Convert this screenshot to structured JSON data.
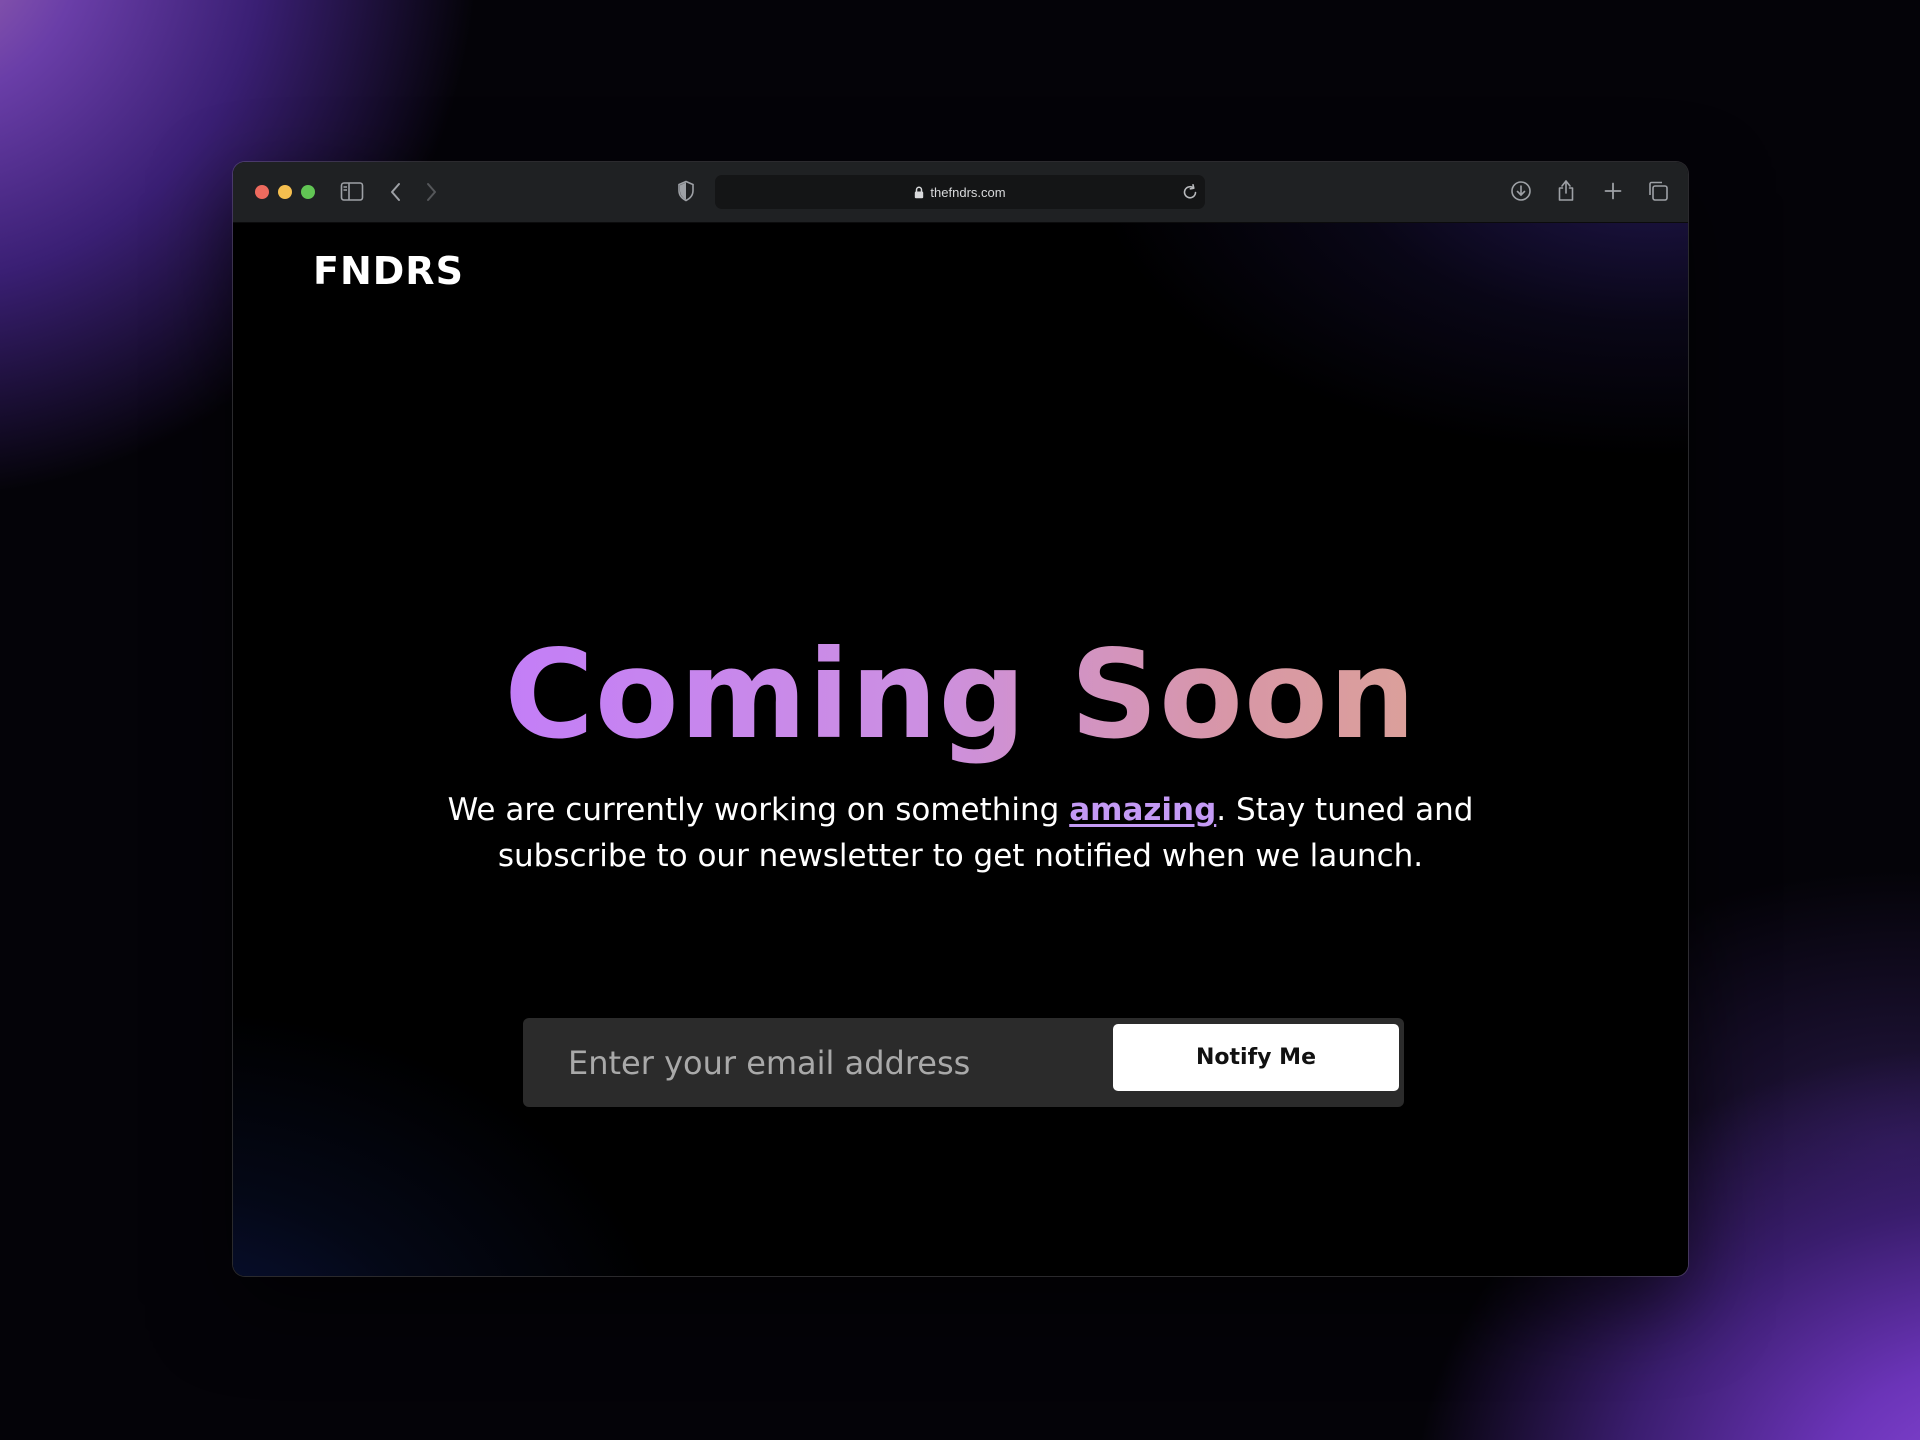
{
  "browser": {
    "url": "thefndrs.com"
  },
  "page": {
    "logo": "FNDRS",
    "headline": "Coming Soon",
    "subtext": {
      "before": "We are currently working on something ",
      "highlight": "amazing",
      "after": ". Stay tuned and subscribe to our newsletter to get notified when we launch."
    },
    "signup": {
      "email_placeholder": "Enter your email address",
      "email_value": "",
      "button_label": "Notify Me"
    }
  },
  "colors": {
    "headline_gradient_start": "#c37ef7",
    "headline_gradient_end": "#dba09a",
    "highlight": "#c49af5",
    "input_background": "#2b2b2b",
    "button_background": "#ffffff"
  }
}
